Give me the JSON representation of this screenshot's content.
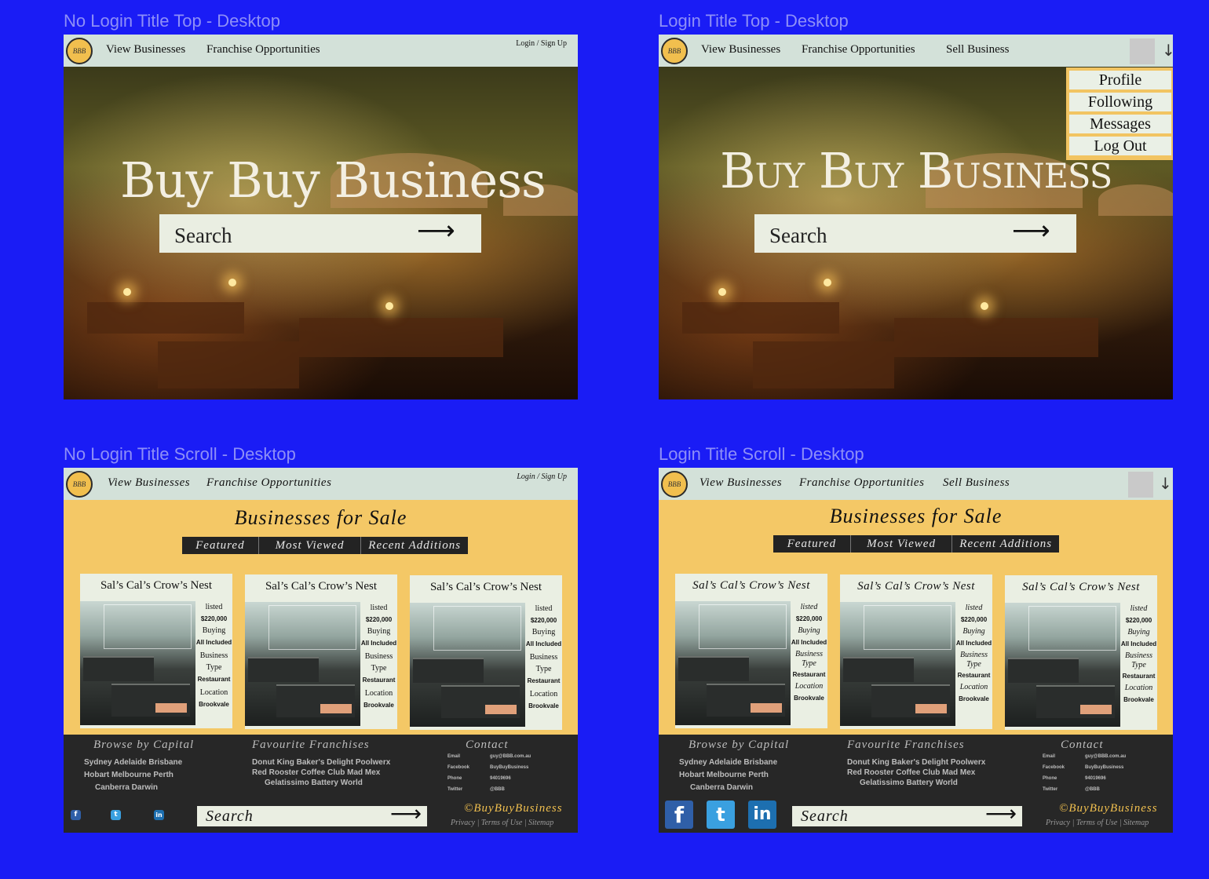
{
  "labels": {
    "f1": "No Login Title Top - Desktop",
    "f2": "Login Title Top - Desktop",
    "f3": "No Login Title Scroll - Desktop",
    "f4": "Login Title Scroll - Desktop"
  },
  "logo_text": "BBB",
  "nav": {
    "view": "View Businesses",
    "franchise": "Franchise Opportunities",
    "sell": "Sell Business",
    "login": "Login / Sign Up"
  },
  "avatar_caret": "↓",
  "hero": {
    "title": "Buy Buy Business",
    "search_placeholder": "Search",
    "arrow": "⟶"
  },
  "dropdown": [
    "Profile",
    "Following",
    "Messages",
    "Log Out"
  ],
  "listing": {
    "title": "Businesses for Sale",
    "tabs": [
      "Featured",
      "Most Viewed",
      "Recent Additions"
    ]
  },
  "card": {
    "name": "Sal’s Cal’s Crow’s Nest",
    "listed": "listed",
    "price": "$220,000",
    "buying": "Buying",
    "included": "All Included",
    "business": "Business",
    "type": "Type",
    "type_value": "Restaurant",
    "location": "Location",
    "location_value": "Brookvale"
  },
  "footer": {
    "browse_title": "Browse by Capital",
    "capitals_row1": "Sydney     Adelaide     Brisbane",
    "capitals_row2": "Hobart     Melbourne   Perth",
    "capitals_row3": "Canberra        Darwin",
    "franchise_title": "Favourite Franchises",
    "franchises_row1": "Donut King    Baker's Delight   Poolwerx",
    "franchises_row2": "Red Rooster  Coffee Club      Mad Mex",
    "franchises_row3": "Gelatissimo    Battery World",
    "contact_title": "Contact",
    "contact_labels": [
      "Email",
      "Facebook",
      "Phone",
      "Twitter"
    ],
    "contact_values": [
      "guy@BBB.com.au",
      "BuyBuyBusiness",
      "94019696",
      "@BBB"
    ],
    "search_placeholder": "Search",
    "arrow": "⟶",
    "copyright": "©BuyBuyBusiness",
    "legal": "Privacy | Terms of Use | Sitemap",
    "social": [
      "f",
      "t",
      "in"
    ]
  }
}
